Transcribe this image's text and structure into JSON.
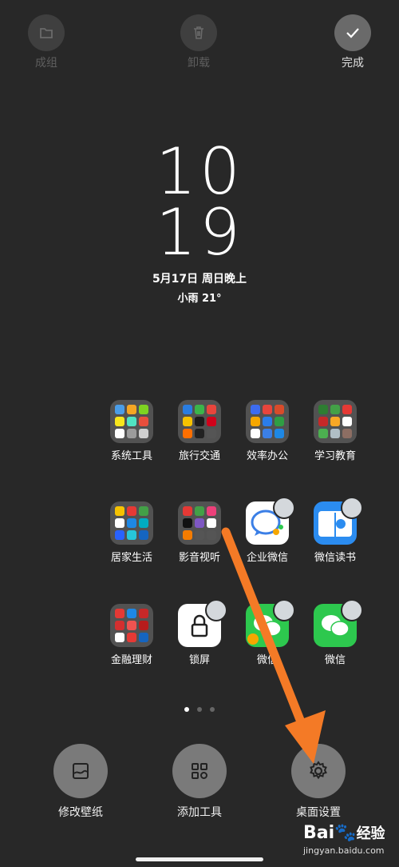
{
  "topbar": {
    "group_label": "成组",
    "uninstall_label": "卸载",
    "done_label": "完成"
  },
  "clock": {
    "hour": "10",
    "minute": "19"
  },
  "date": "5月17日 周日晚上",
  "weather": "小雨  21°",
  "apps": [
    {
      "label": "系统工具",
      "type": "folder"
    },
    {
      "label": "旅行交通",
      "type": "folder"
    },
    {
      "label": "效率办公",
      "type": "folder"
    },
    {
      "label": "学习教育",
      "type": "folder"
    },
    {
      "label": "居家生活",
      "type": "folder"
    },
    {
      "label": "影音视听",
      "type": "folder"
    },
    {
      "label": "企业微信",
      "type": "app"
    },
    {
      "label": "微信读书",
      "type": "app"
    },
    {
      "label": "金融理财",
      "type": "folder"
    },
    {
      "label": "锁屏",
      "type": "app"
    },
    {
      "label": "微信",
      "type": "app"
    },
    {
      "label": "微信",
      "type": "app"
    }
  ],
  "page_indicator": {
    "current": 1,
    "total": 3
  },
  "bottom": {
    "wallpaper_label": "修改壁纸",
    "widgets_label": "添加工具",
    "settings_label": "桌面设置"
  },
  "watermark": {
    "brand": "Bai",
    "brand_suffix": "经验",
    "url": "jingyan.baidu.com"
  },
  "colors": {
    "background": "#282828",
    "arrow": "#f47a26",
    "wechat_green": "#2dc84e",
    "qywx_blue": "#3b7fe6",
    "weread_blue": "#2b8cf0"
  }
}
